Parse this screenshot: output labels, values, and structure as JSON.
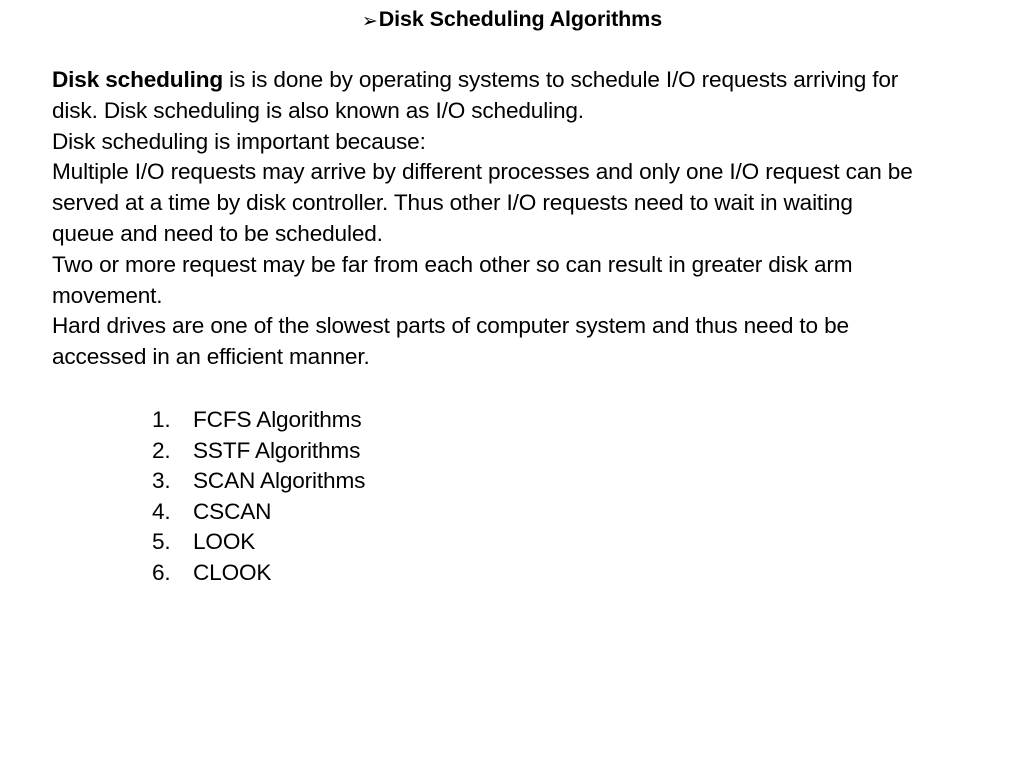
{
  "slide": {
    "background_color": "#ffffff",
    "text_color": "#000000",
    "title": {
      "bullet_glyph": "➢",
      "text": "Disk Scheduling Algorithms"
    },
    "body_lines": [
      {
        "bold_prefix": "Disk scheduling",
        "text": " is is done by operating systems to schedule I/O requests arriving for"
      },
      {
        "bold_prefix": "",
        "text": "disk. Disk scheduling is also known as I/O scheduling."
      },
      {
        "bold_prefix": "",
        "text": "Disk scheduling is important because:"
      },
      {
        "bold_prefix": "",
        "text": "Multiple I/O requests may arrive by different processes and only one I/O request can be"
      },
      {
        "bold_prefix": "",
        "text": "served at a time by disk controller. Thus other I/O requests need to wait in waiting"
      },
      {
        "bold_prefix": "",
        "text": "queue and need to be scheduled."
      },
      {
        "bold_prefix": "",
        "text": "Two or more request may be far from each other so can result in greater disk arm"
      },
      {
        "bold_prefix": "",
        "text": "movement."
      },
      {
        "bold_prefix": "",
        "text": "Hard drives are one of the slowest parts of computer system and thus need to be"
      },
      {
        "bold_prefix": "",
        "text": "accessed in an efficient manner."
      }
    ],
    "algorithm_list": [
      {
        "number": "1.",
        "label": "FCFS Algorithms"
      },
      {
        "number": "2.",
        "label": "SSTF Algorithms"
      },
      {
        "number": "3.",
        "label": "SCAN Algorithms"
      },
      {
        "number": "4.",
        "label": "CSCAN"
      },
      {
        "number": "5.",
        "label": "LOOK"
      },
      {
        "number": "6.",
        "label": "CLOOK"
      }
    ]
  }
}
